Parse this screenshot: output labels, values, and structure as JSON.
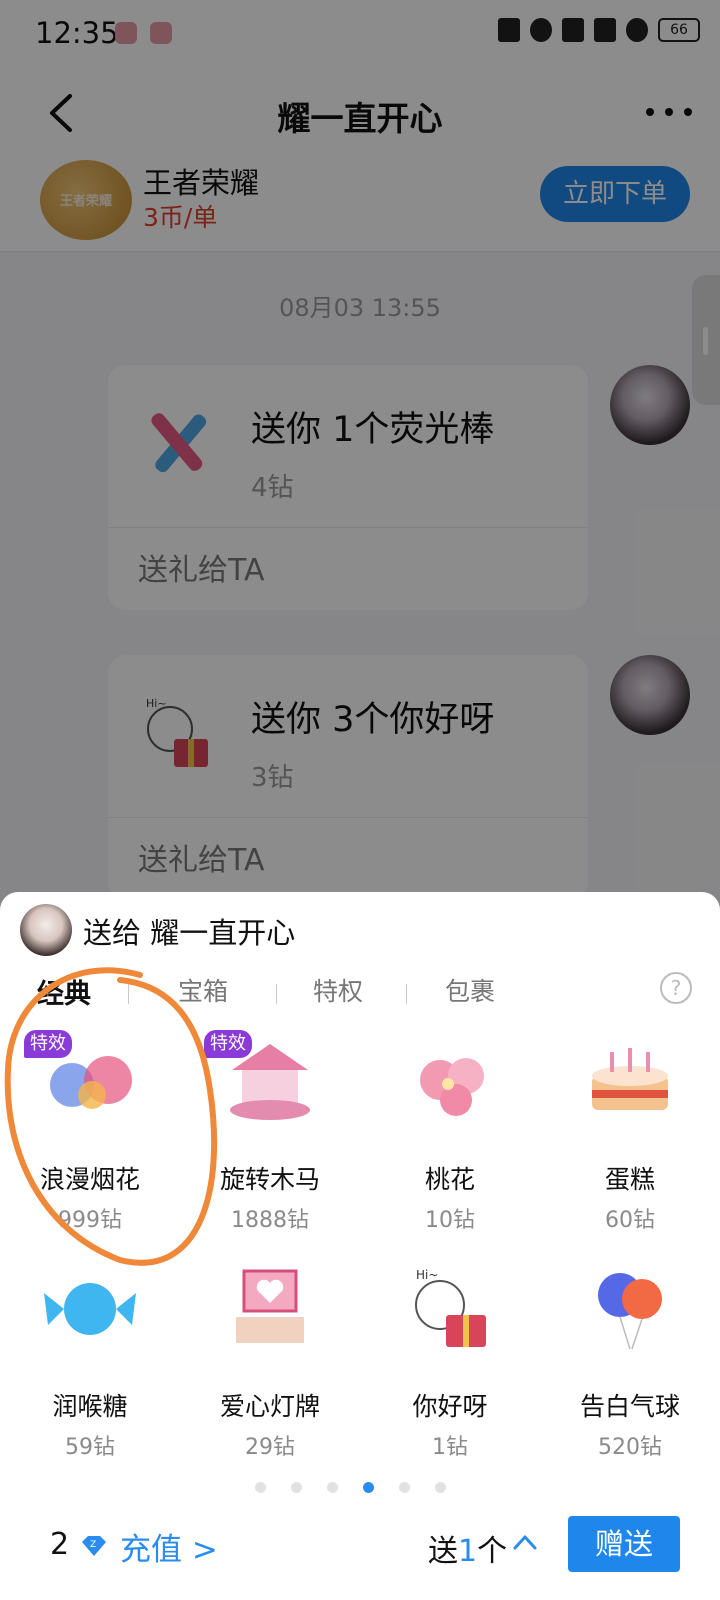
{
  "status_bar": {
    "time": "12:35",
    "battery": "66"
  },
  "nav": {
    "title": "耀一直开心"
  },
  "game": {
    "name": "王者荣耀",
    "price": "3币/单",
    "order_button": "立即下单",
    "logo_text": "王者荣耀"
  },
  "chat": {
    "timestamp": "08月03 13:55",
    "messages": [
      {
        "title": "送你 1个荧光棒",
        "price": "4钻",
        "action": "送礼给TA"
      },
      {
        "title": "送你 3个你好呀",
        "price": "3钻",
        "action": "送礼给TA"
      }
    ]
  },
  "sheet": {
    "send_to": "送给 耀一直开心",
    "tabs": [
      {
        "label": "经典"
      },
      {
        "label": "宝箱"
      },
      {
        "label": "特权"
      },
      {
        "label": "包裹"
      }
    ],
    "help": "?",
    "gifts": [
      {
        "name": "浪漫烟花",
        "price": "999钻",
        "badge": "特效"
      },
      {
        "name": "旋转木马",
        "price": "1888钻",
        "badge": "特效"
      },
      {
        "name": "桃花",
        "price": "10钻"
      },
      {
        "name": "蛋糕",
        "price": "60钻"
      },
      {
        "name": "润喉糖",
        "price": "59钻"
      },
      {
        "name": "爱心灯牌",
        "price": "29钻"
      },
      {
        "name": "你好呀",
        "price": "1钻"
      },
      {
        "name": "告白气球",
        "price": "520钻"
      }
    ],
    "page_count": 6,
    "current_page": 4,
    "balance": "2",
    "recharge": "充值 >",
    "quantity_prefix": "送",
    "quantity": "1",
    "quantity_suffix": "个",
    "send_button": "赠送"
  },
  "colors": {
    "accent": "#1f86ec",
    "price_red": "#e0402e",
    "badge_purple": "#8a3ad6",
    "annotation": "#f0883a"
  }
}
